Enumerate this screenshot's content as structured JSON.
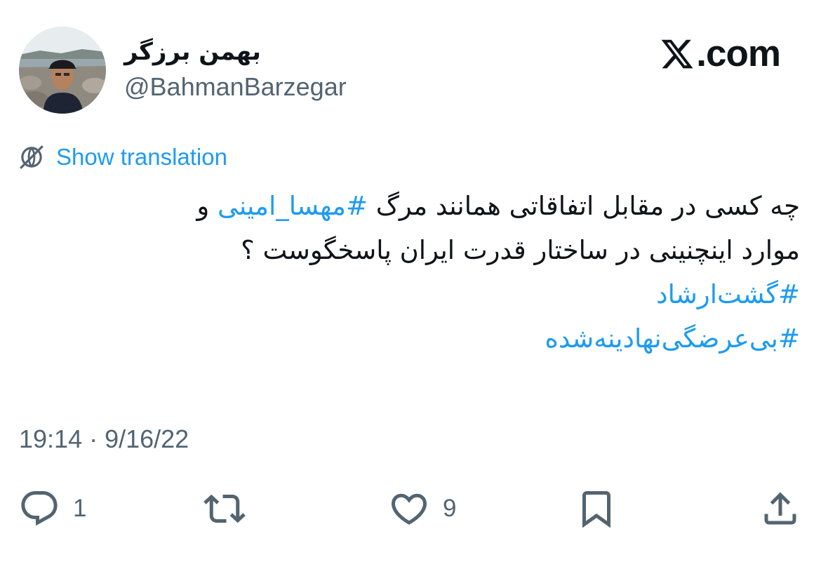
{
  "author": {
    "display_name": "بهمن برزگر",
    "handle": "@BahmanBarzegar"
  },
  "brand": {
    "text": ".com",
    "logo_icon": "x-logo-icon"
  },
  "translation": {
    "label": "Show translation",
    "icon": "translate-globe-icon"
  },
  "tweet": {
    "line1_text": "چه کسی در مقابل اتفاقاتی همانند مرگ ",
    "line1_hashtag": "#مهسا_امینی",
    "line1_suffix": " و",
    "line2_text": "موارد اینچنینی در ساختار قدرت ایران پاسخگوست ؟",
    "hashtag_1": "#گشت‌ارشاد",
    "hashtag_2": "#بی‌عرضگی‌نهادینه‌شده"
  },
  "timestamp": "19:14 · 9/16/22",
  "actions": {
    "reply_count": "1",
    "retweet_count": "",
    "like_count": "9"
  },
  "colors": {
    "accent": "#1d9bf0",
    "text": "#0f1419",
    "muted": "#536471"
  }
}
